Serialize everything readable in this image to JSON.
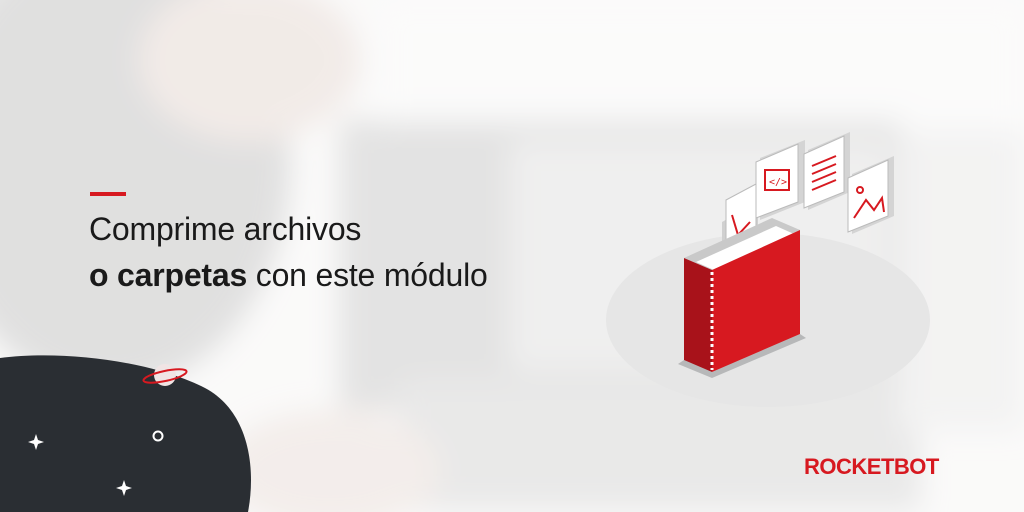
{
  "banner": {
    "headline_line1": "Comprime archivos",
    "headline_line2_bold": "o carpetas",
    "headline_line2_rest": " con este módulo",
    "brand": "ROCKETBOT"
  },
  "colors": {
    "accent": "#d71920",
    "dark": "#2a2e33",
    "ellipse": "#e6e6e6"
  },
  "icons": [
    "folder-icon",
    "code-icon",
    "document-icon",
    "image-icon",
    "graph-icon",
    "planet-icon",
    "sparkle-icon"
  ]
}
